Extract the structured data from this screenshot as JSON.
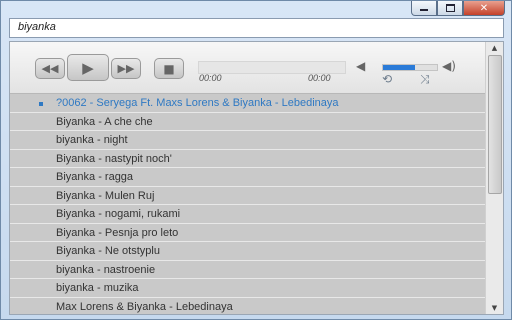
{
  "search": {
    "value": "biyanka"
  },
  "window": {
    "minimize": "minimize",
    "maximize": "maximize",
    "close": "✕"
  },
  "player": {
    "time_current": "00:00",
    "time_total": "00:00",
    "progress": 0,
    "volume": 0.6,
    "accent_color": "#2b7bd8",
    "icons": {
      "prev": "backward-icon",
      "play": "play-icon",
      "next": "forward-icon",
      "stop": "stop-icon",
      "volume_low": "speaker-low-icon",
      "volume_high": "speaker-high-icon",
      "repeat": "repeat-icon",
      "shuffle": "shuffle-icon"
    }
  },
  "playlist": {
    "active_color": "#2f79c3",
    "items": [
      {
        "label": "?0062 - Seryega Ft. Maxs Lorens & Biyanka - Lebedinaya",
        "active": true
      },
      {
        "label": "Biyanka - A che che"
      },
      {
        "label": "biyanka - night"
      },
      {
        "label": "Biyanka - nastypit noch'"
      },
      {
        "label": "Biyanka - ragga"
      },
      {
        "label": "Biyanka - Mulen Ruj"
      },
      {
        "label": "Biyanka - nogami, rukami"
      },
      {
        "label": "Biyanka - Pesnja pro leto"
      },
      {
        "label": "Biyanka - Ne otstyplu"
      },
      {
        "label": "biyanka - nastroenie"
      },
      {
        "label": "biyanka - muzika"
      },
      {
        "label": "Max Lorens & Biyanka - Lebedinaya"
      }
    ]
  }
}
